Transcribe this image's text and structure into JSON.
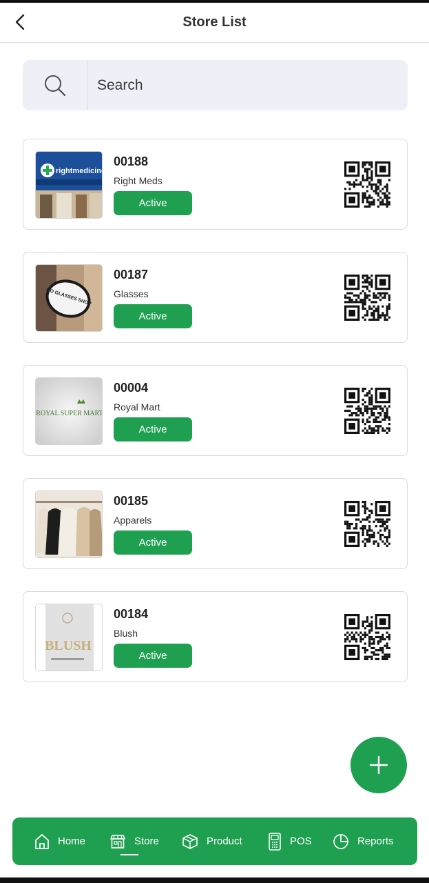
{
  "header": {
    "title": "Store List"
  },
  "search": {
    "placeholder": "Search"
  },
  "stores": [
    {
      "code": "00188",
      "name": "Right Meds",
      "status": "Active",
      "thumb_text": "rightmedicine"
    },
    {
      "code": "00187",
      "name": "Glasses",
      "status": "Active",
      "thumb_text": "GO GLASSES SHOP"
    },
    {
      "code": "00004",
      "name": "Royal Mart",
      "status": "Active",
      "thumb_text": "ROYAL SUPER MART"
    },
    {
      "code": "00185",
      "name": "Apparels",
      "status": "Active"
    },
    {
      "code": "00184",
      "name": "Blush",
      "status": "Active",
      "thumb_text": "BLUSH"
    }
  ],
  "nav": {
    "items": [
      {
        "label": "Home",
        "icon": "home-icon"
      },
      {
        "label": "Store",
        "icon": "store-icon",
        "active": true
      },
      {
        "label": "Product",
        "icon": "box-icon"
      },
      {
        "label": "POS",
        "icon": "pos-terminal-icon"
      },
      {
        "label": "Reports",
        "icon": "pie-chart-icon"
      }
    ]
  },
  "colors": {
    "accent": "#1fa050",
    "search_bg": "#edf0f6",
    "card_border": "#d9d9d9"
  }
}
